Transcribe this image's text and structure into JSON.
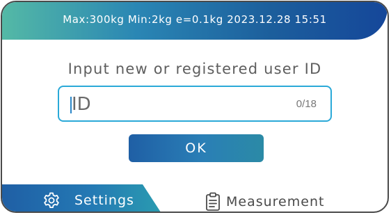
{
  "status_bar": {
    "text": "Max:300kg Min:2kg e=0.1kg 2023.12.28 15:51"
  },
  "main": {
    "prompt": "Input new or registered user ID",
    "id_field": {
      "placeholder": "ID",
      "value": "",
      "counter": "0/18"
    },
    "ok_label": "OK"
  },
  "tabs": {
    "settings": {
      "label": "Settings",
      "icon": "gear-icon",
      "active": true
    },
    "measurement": {
      "label": "Measurement",
      "icon": "clipboard-icon",
      "active": false
    }
  },
  "colors": {
    "accent_blue": "#1f5fa5",
    "field_border": "#2aa9d8",
    "status_gradient_start": "#54b9a6",
    "status_gradient_end": "#15479a"
  }
}
